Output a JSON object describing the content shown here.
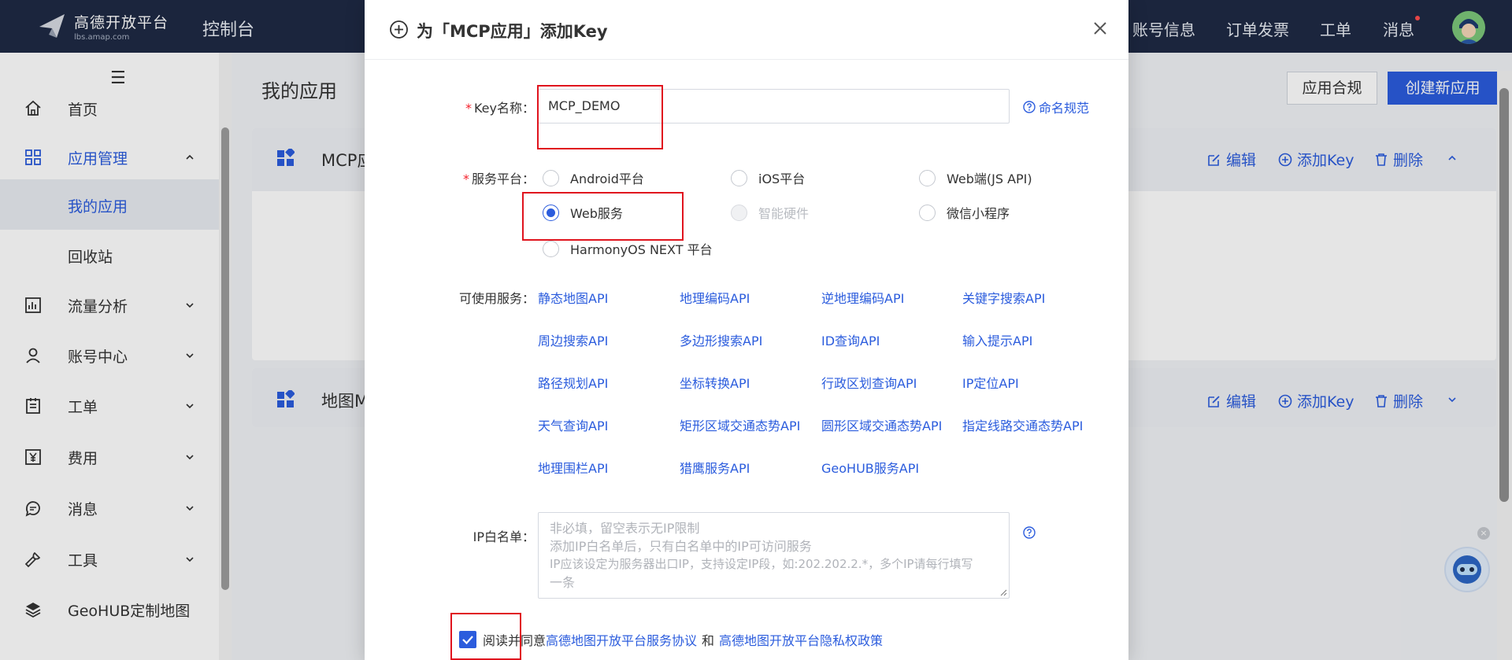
{
  "header": {
    "logo_title": "高德开放平台",
    "logo_sub": "lbs.amap.com",
    "console_label": "控制台",
    "nav": [
      "账号信息",
      "订单发票",
      "工单",
      "消息"
    ]
  },
  "sidebar": {
    "items": [
      {
        "label": "首页",
        "icon": "home-icon"
      },
      {
        "label": "应用管理",
        "icon": "apps-grid-icon"
      },
      {
        "label": "我的应用"
      },
      {
        "label": "回收站"
      },
      {
        "label": "流量分析",
        "icon": "chart-icon"
      },
      {
        "label": "账号中心",
        "icon": "user-icon"
      },
      {
        "label": "工单",
        "icon": "clipboard-icon"
      },
      {
        "label": "费用",
        "icon": "yuan-icon"
      },
      {
        "label": "消息",
        "icon": "message-icon"
      },
      {
        "label": "工具",
        "icon": "wrench-icon"
      },
      {
        "label": "GeoHUB定制地图",
        "icon": "layers-icon"
      }
    ]
  },
  "main": {
    "title": "我的应用",
    "btn_compliance": "应用合规",
    "btn_create": "创建新应用",
    "cards": [
      {
        "title": "MCP应",
        "edit": "编辑",
        "add_key": "添加Key",
        "delete": "删除"
      },
      {
        "title": "地图M",
        "edit": "编辑",
        "add_key": "添加Key",
        "delete": "删除"
      }
    ]
  },
  "modal": {
    "title": "为「MCP应用」添加Key",
    "key_name_label": "Key名称：",
    "key_name_value": "MCP_DEMO",
    "naming_rule_link": "命名规范",
    "platform_label": "服务平台：",
    "platforms": [
      {
        "label": "Android平台",
        "state": "unchecked"
      },
      {
        "label": "iOS平台",
        "state": "unchecked"
      },
      {
        "label": "Web端(JS API)",
        "state": "unchecked"
      },
      {
        "label": "Web服务",
        "state": "checked"
      },
      {
        "label": "智能硬件",
        "state": "disabled"
      },
      {
        "label": "微信小程序",
        "state": "unchecked"
      },
      {
        "label": "HarmonyOS NEXT 平台",
        "state": "unchecked"
      }
    ],
    "services_label": "可使用服务：",
    "services": [
      "静态地图API",
      "地理编码API",
      "逆地理编码API",
      "关键字搜索API",
      "周边搜索API",
      "多边形搜索API",
      "ID查询API",
      "输入提示API",
      "路径规划API",
      "坐标转换API",
      "行政区划查询API",
      "IP定位API",
      "天气查询API",
      "矩形区域交通态势API",
      "圆形区域交通态势API",
      "指定线路交通态势API",
      "地理围栏API",
      "猎鹰服务API",
      "GeoHUB服务API"
    ],
    "ip_label": "IP白名单：",
    "ip_placeholder_lines": [
      "非必填，留空表示无IP限制",
      "添加IP白名单后，只有白名单中的IP可访问服务",
      "IP应该设定为服务器出口IP，支持设定IP段，如:202.202.2.*，多个IP请每行填写",
      "一条"
    ],
    "agree_text": "阅读并同意",
    "agree_link_1": "高德地图开放平台服务协议",
    "agree_and": "和",
    "agree_link_2": "高德地图开放平台隐私权政策",
    "agree_checked": true
  },
  "colors": {
    "accent": "#2b5cdd",
    "highlight": "#e0141e",
    "header_bg": "#1f2a44"
  }
}
